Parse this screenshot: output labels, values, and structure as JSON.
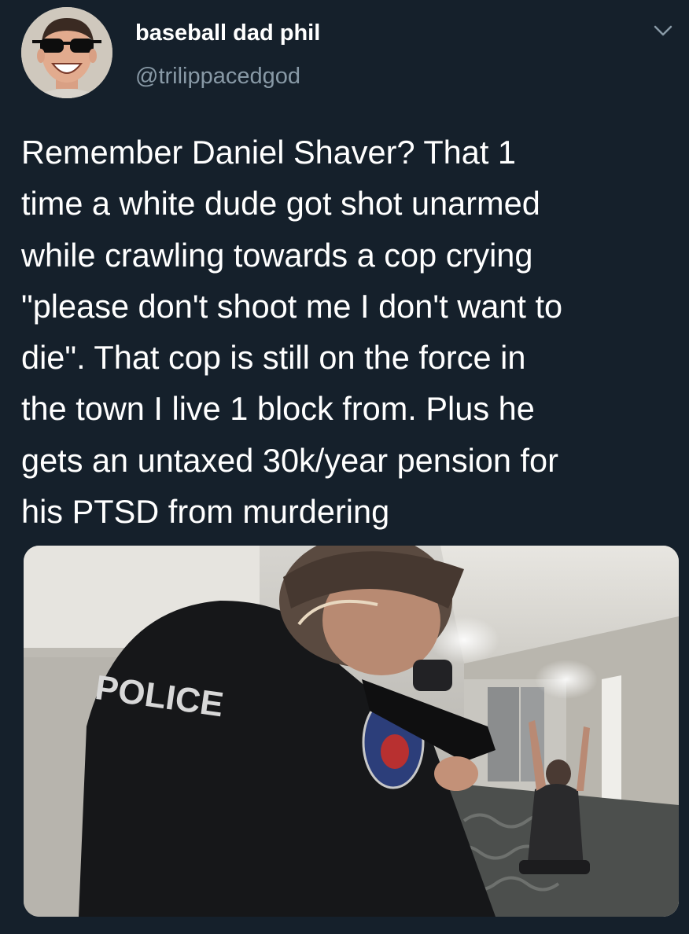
{
  "tweet": {
    "display_name": "baseball dad phil",
    "handle": "@trilippacedgod",
    "text": "Remember Daniel Shaver? That 1\ntime a white dude got shot unarmed\nwhile crawling towards a cop crying\n\"please don't shoot me I don't want to\ndie\". That cop is still on the force in\nthe town I live 1 block from. Plus he\ngets an untaxed 30k/year pension for\nhis PTSD from murdering",
    "media": {
      "description_icon": "bodycam-photo",
      "vest_text": "POLICE"
    }
  },
  "colors": {
    "background": "#15202b",
    "primary_text": "#ffffff",
    "secondary_text": "#8899a6"
  },
  "icons": {
    "menu": "chevron-down-icon",
    "avatar": "avatar"
  }
}
